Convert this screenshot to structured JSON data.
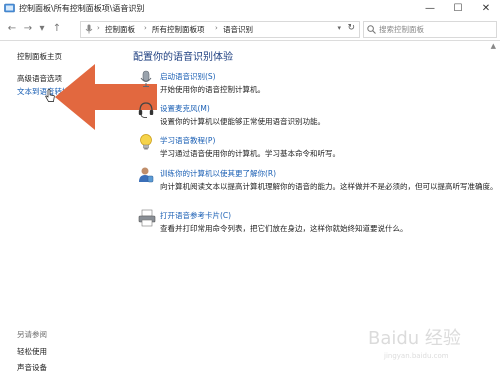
{
  "window": {
    "title": "控制面板\\所有控制面板项\\语音识别",
    "minimize": "—",
    "maximize": "☐",
    "close": "✕"
  },
  "nav": {
    "back": "←",
    "forward": "→",
    "dropdown": "▾",
    "up": "↑"
  },
  "address": {
    "crumbs": [
      "控制面板",
      "所有控制面板项",
      "语音识别"
    ],
    "separator": "›",
    "dropdown": "▾",
    "refresh": "↻"
  },
  "search": {
    "placeholder": "搜索控制面板"
  },
  "sidebar": {
    "items": [
      {
        "label": "控制面板主页"
      },
      {
        "label": "高级语音选项"
      },
      {
        "label": "文本到语音转换"
      }
    ],
    "see_also": "另请参阅",
    "see_also_items": [
      {
        "label": "轻松使用"
      },
      {
        "label": "声音设备"
      }
    ]
  },
  "main": {
    "title": "配置你的语音识别体验",
    "items": [
      {
        "icon": "microphone-icon",
        "link": "启动语音识别(S)",
        "desc": "开始使用你的语音控制计算机。"
      },
      {
        "icon": "headset-icon",
        "link": "设置麦克风(M)",
        "desc": "设置你的计算机以便能够正常使用语音识别功能。"
      },
      {
        "icon": "lightbulb-icon",
        "link": "学习语音教程(P)",
        "desc": "学习通过语音使用你的计算机。学习基本命令和听写。"
      },
      {
        "icon": "user-training-icon",
        "link": "训练你的计算机以使其更了解你(R)",
        "desc": "向计算机阅读文本以提高计算机理解你的语音的能力。这样做并不是必须的，但可以提高听写准确度。"
      },
      {
        "icon": "printer-icon",
        "link": "打开语音参考卡片(C)",
        "desc": "查看并打印常用命令列表，把它们放在身边，这样你就始终知道要说什么。"
      }
    ]
  },
  "colors": {
    "link": "#1a5fb4",
    "title": "#1e3f80",
    "arrow": "#e2683f"
  },
  "watermark": {
    "text": "Baidu 经验",
    "sub": "jingyan.baidu.com"
  }
}
